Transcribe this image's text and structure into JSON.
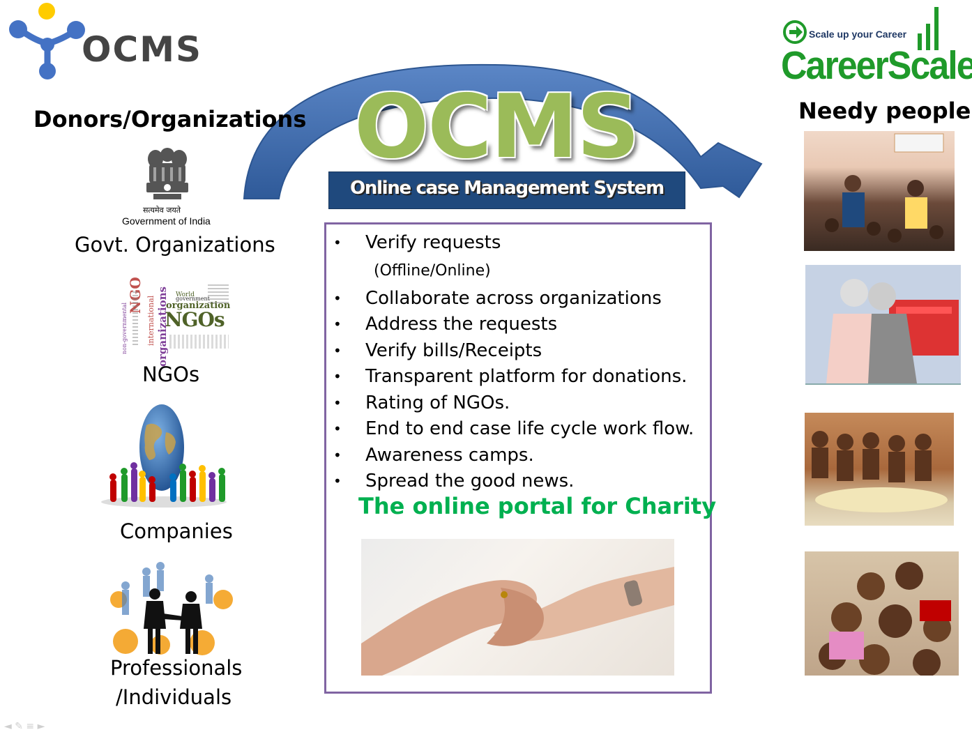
{
  "logo": {
    "text": "OCMS"
  },
  "partner_logo": {
    "tagline": "Scale up your Career",
    "name": "CareerScale"
  },
  "left": {
    "heading": "Donors/Organizations",
    "emblem_caption": "Government of India",
    "emblem_motto": "सत्यमेव जयते",
    "categories": [
      "Govt. Organizations",
      "NGOs",
      "Companies",
      "Professionals",
      "/Individuals"
    ],
    "ngo_cloud_words": [
      "NGO",
      "NGOs",
      "organization",
      "international",
      "non-governmental",
      "organizations",
      "World",
      "government"
    ]
  },
  "center": {
    "title": "OCMS",
    "subtitle": "Online case Management System",
    "bullets": [
      "Verify requests",
      "(Offline/Online)",
      "Collaborate across organizations",
      "Address the requests",
      "Verify bills/Receipts",
      "Transparent platform for donations.",
      "Rating of NGOs.",
      "End to end case life cycle work flow.",
      "Awareness camps.",
      "Spread the good news."
    ],
    "tagline": "The online portal for Charity"
  },
  "right": {
    "heading": "Needy people"
  },
  "colors": {
    "accent_green": "#9bbb59",
    "tagline_green": "#00b050",
    "banner_blue": "#1f497d",
    "arrow_blue": "#3f6fb0",
    "box_purple": "#8064a2",
    "career_green": "#1f9a2a"
  },
  "icons": [
    "network-logo-icon",
    "curved-arrow-icon",
    "state-emblem-icon",
    "globe-icon",
    "handshake-icon",
    "bar-chart-icon",
    "right-arrow-circle-icon"
  ]
}
